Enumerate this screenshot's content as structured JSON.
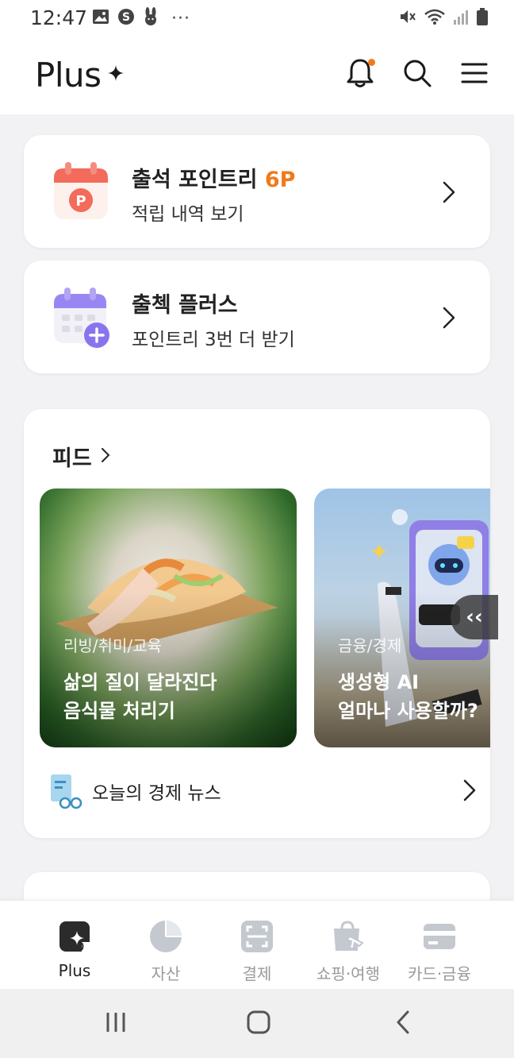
{
  "status_bar": {
    "time": "12:47",
    "left_icons": [
      "gallery-icon",
      "s-app-icon",
      "rabbit-app-icon"
    ],
    "more": "···",
    "right_icons": [
      "mute-icon",
      "wifi-icon",
      "signal-icon",
      "battery-icon"
    ]
  },
  "header": {
    "title": "Plus",
    "actions": [
      "bell-icon",
      "search-icon",
      "menu-icon"
    ],
    "has_notification": true
  },
  "attendance_card": {
    "title": "출석 포인트리 ",
    "title_points": "6P",
    "subtitle": "적립 내역 보기",
    "icon": "calendar-point-icon"
  },
  "plus_card": {
    "title": "출첵 플러스",
    "subtitle": "포인트리 3번 더 받기",
    "icon": "calendar-plus-icon"
  },
  "feed": {
    "title": "피드",
    "items": [
      {
        "category": "리빙/취미/교육",
        "line1": "삶의 질이 달라진다",
        "line2": "음식물 처리기"
      },
      {
        "category": "금융/경제",
        "line1": "생성형 AI",
        "line2": "얼마나 사용할까?"
      }
    ],
    "more_button": "‹‹",
    "news_label": "오늘의 경제 뉴스"
  },
  "bottom_nav": {
    "tabs": [
      {
        "label": "Plus",
        "icon": "plus-sparkle-icon",
        "active": true
      },
      {
        "label": "자산",
        "icon": "pie-chart-icon",
        "active": false
      },
      {
        "label": "결제",
        "icon": "scan-pay-icon",
        "active": false
      },
      {
        "label": "쇼핑·여행",
        "icon": "shopping-bag-plane-icon",
        "active": false
      },
      {
        "label": "카드·금융",
        "icon": "credit-card-icon",
        "active": false
      }
    ]
  },
  "system_nav": [
    "recent-apps-icon",
    "home-icon",
    "back-icon"
  ],
  "colors": {
    "accent": "#f07a1a",
    "notification_dot": "#f4771c",
    "background": "#f2f2f4",
    "calendar_red": "#f26b5b",
    "calendar_purple": "#8e7bf0"
  }
}
